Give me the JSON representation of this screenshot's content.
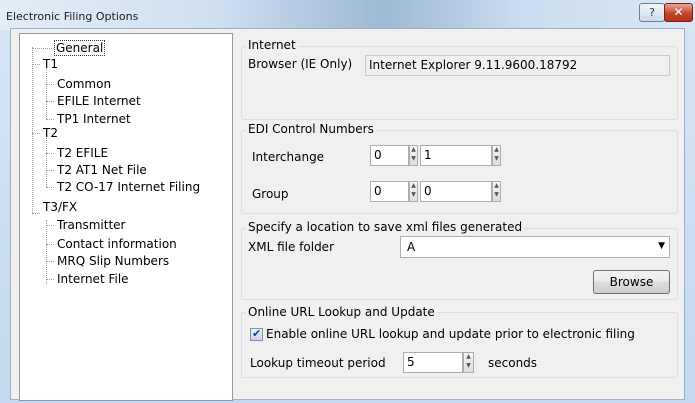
{
  "window": {
    "title": "Electronic Filing Options",
    "help_label": "?",
    "close_label": "✕"
  },
  "tree": [
    {
      "label": "General",
      "level": 1,
      "selected": true
    },
    {
      "label": "T1",
      "level": 0
    },
    {
      "label": "Common",
      "level": 1
    },
    {
      "label": "EFILE Internet",
      "level": 1
    },
    {
      "label": "TP1 Internet",
      "level": 1
    },
    {
      "label": "T2",
      "level": 0
    },
    {
      "label": "T2 EFILE",
      "level": 1
    },
    {
      "label": "T2 AT1 Net File",
      "level": 1
    },
    {
      "label": "T2 CO-17 Internet Filing",
      "level": 1
    },
    {
      "label": "T3/FX",
      "level": 0
    },
    {
      "label": "Transmitter",
      "level": 1
    },
    {
      "label": "Contact information",
      "level": 1
    },
    {
      "label": "MRQ Slip Numbers",
      "level": 1
    },
    {
      "label": "Internet File",
      "level": 1
    }
  ],
  "internet": {
    "group_title": "Internet",
    "browser_label": "Browser (IE Only)",
    "browser_value": "Internet Explorer 9.11.9600.18792"
  },
  "edi": {
    "group_title": "EDI Control Numbers",
    "interchange_label": "Interchange",
    "interchange_value1": "0",
    "interchange_value2": "1",
    "group_label": "Group",
    "group_value1": "0",
    "group_value2": "0"
  },
  "xml": {
    "group_title": "Specify a location to save xml files generated",
    "folder_label": "XML file folder",
    "folder_value": "A",
    "browse_label": "Browse"
  },
  "online": {
    "group_title": "Online URL Lookup and Update",
    "enable_checked": true,
    "enable_label": "Enable online URL lookup and update prior to electronic filing",
    "timeout_label": "Lookup timeout period",
    "timeout_value": "5",
    "seconds_label": "seconds"
  }
}
